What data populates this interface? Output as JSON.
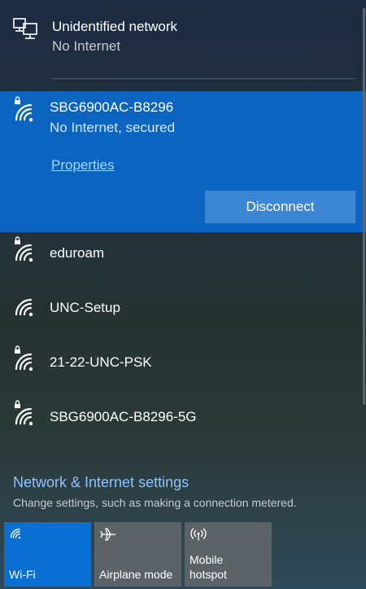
{
  "wired": {
    "name": "Unidentified network",
    "status": "No Internet"
  },
  "selected_network": {
    "name": "SBG6900AC-B8296",
    "status": "No Internet, secured",
    "properties_label": "Properties",
    "disconnect_label": "Disconnect"
  },
  "networks": [
    {
      "name": "eduroam",
      "secured": true
    },
    {
      "name": "UNC-Setup",
      "secured": false
    },
    {
      "name": "21-22-UNC-PSK",
      "secured": true
    },
    {
      "name": "SBG6900AC-B8296-5G",
      "secured": true
    }
  ],
  "settings": {
    "title": "Network & Internet settings",
    "description": "Change settings, such as making a connection metered."
  },
  "quick_actions": [
    {
      "label": "Wi-Fi",
      "icon": "wifi-icon",
      "active": true
    },
    {
      "label": "Airplane mode",
      "icon": "airplane-icon",
      "active": false
    },
    {
      "label_line1": "Mobile",
      "label_line2": "hotspot",
      "icon": "hotspot-icon",
      "active": false
    }
  ]
}
